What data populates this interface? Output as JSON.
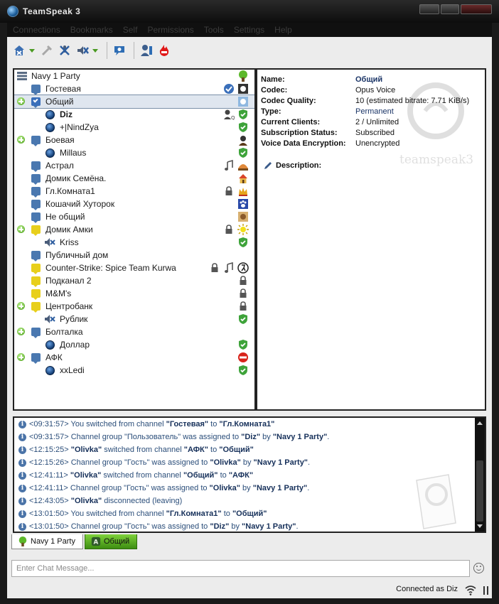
{
  "window": {
    "title": "TeamSpeak 3"
  },
  "menu": [
    "Connections",
    "Bookmarks",
    "Self",
    "Permissions",
    "Tools",
    "Settings",
    "Help"
  ],
  "tree": {
    "server": "Navy 1 Party",
    "rows": [
      {
        "kind": "channel",
        "label": "Гостевая"
      },
      {
        "kind": "channel",
        "label": "Общий"
      },
      {
        "kind": "user",
        "label": "Diz"
      },
      {
        "kind": "user",
        "label": "+|NindZya"
      },
      {
        "kind": "channel",
        "label": "Боевая"
      },
      {
        "kind": "user",
        "label": "Millaus"
      },
      {
        "kind": "channel",
        "label": "Астрал"
      },
      {
        "kind": "channel",
        "label": "Домик Семёна."
      },
      {
        "kind": "channel",
        "label": "Гл.Комната1"
      },
      {
        "kind": "channel",
        "label": "Кошачий Хуторок"
      },
      {
        "kind": "channel",
        "label": "Не общий"
      },
      {
        "kind": "channel",
        "label": "Домик Амки"
      },
      {
        "kind": "user",
        "label": "Kriss"
      },
      {
        "kind": "channel",
        "label": "Публичный дом"
      },
      {
        "kind": "channel",
        "label": "Counter-Strike: Spice Team Kurwa"
      },
      {
        "kind": "channel",
        "label": "Подканал 2"
      },
      {
        "kind": "channel",
        "label": "M&M's"
      },
      {
        "kind": "channel",
        "label": "Центробанк"
      },
      {
        "kind": "user",
        "label": "Рублик"
      },
      {
        "kind": "channel",
        "label": "Болталка"
      },
      {
        "kind": "user",
        "label": "Доллар"
      },
      {
        "kind": "channel",
        "label": "АФК"
      },
      {
        "kind": "user",
        "label": "xxLedi"
      }
    ]
  },
  "info": {
    "fields": [
      {
        "key": "Name:",
        "value": "Общий"
      },
      {
        "key": "Codec:",
        "value": "Opus Voice"
      },
      {
        "key": "Codec Quality:",
        "value": "10 (estimated bitrate: 7.71 KiB/s)"
      },
      {
        "key": "Type:",
        "value": "Permanent"
      },
      {
        "key": "Current Clients:",
        "value": "2 / Unlimited"
      },
      {
        "key": "Subscription Status:",
        "value": "Subscribed"
      },
      {
        "key": "Voice Data Encryption:",
        "value": "Unencrypted"
      }
    ],
    "description_label": "Description:",
    "watermark": "teamspeak3"
  },
  "log": {
    "lines": [
      {
        "time": "<09:31:57>",
        "parts": [
          " You switched from channel ",
          "\"Гостевая\"",
          " to ",
          "\"Гл.Комната1\""
        ]
      },
      {
        "time": "<09:31:57>",
        "parts": [
          " Channel group \"Пользователь\" was assigned to ",
          "\"Diz\"",
          " by ",
          "\"Navy 1 Party\"",
          "."
        ]
      },
      {
        "time": "<12:15:25>",
        "parts": [
          " ",
          "\"Olivka\"",
          " switched from channel ",
          "\"АФК\"",
          " to ",
          "\"Общий\""
        ]
      },
      {
        "time": "<12:15:26>",
        "parts": [
          " Channel group \"Гость\" was assigned to ",
          "\"Olivka\"",
          " by ",
          "\"Navy 1 Party\"",
          "."
        ]
      },
      {
        "time": "<12:41:11>",
        "parts": [
          " ",
          "\"Olivka\"",
          " switched from channel ",
          "\"Общий\"",
          " to ",
          "\"АФК\""
        ]
      },
      {
        "time": "<12:41:11>",
        "parts": [
          " Channel group \"Гость\" was assigned to ",
          "\"Olivka\"",
          " by ",
          "\"Navy 1 Party\"",
          "."
        ]
      },
      {
        "time": "<12:43:05>",
        "parts": [
          " ",
          "\"Olivka\"",
          " disconnected (leaving)"
        ]
      },
      {
        "time": "<13:01:50>",
        "parts": [
          " You switched from channel ",
          "\"Гл.Комната1\"",
          " to ",
          "\"Общий\""
        ]
      },
      {
        "time": "<13:01:50>",
        "parts": [
          " Channel group \"Гость\" was assigned to ",
          "\"Diz\"",
          " by ",
          "\"Navy 1 Party\"",
          "."
        ]
      }
    ]
  },
  "tabs": {
    "server": "Navy 1 Party",
    "channel": "Общий"
  },
  "chat": {
    "placeholder": "Enter Chat Message..."
  },
  "status": {
    "text": "Connected as Diz"
  },
  "colors": {
    "accent_green": "#4c9f1c",
    "channel_blue": "#4a78b0",
    "channel_yellow": "#e8cf1c",
    "link_blue": "#1a3466"
  }
}
